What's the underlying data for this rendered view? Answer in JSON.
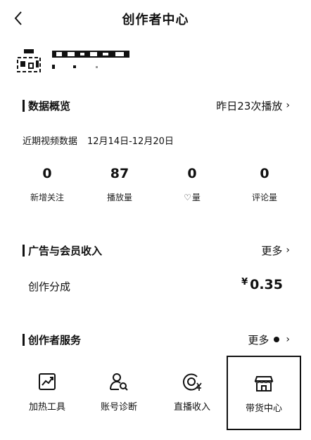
{
  "header": {
    "title": "创作者中心",
    "back_icon": "chevron-left-icon"
  },
  "overview": {
    "title": "数据概览",
    "yesterday": "昨日23次播放",
    "period_label": "近期视频数据",
    "period_range": "12月14日-12月20日",
    "stats": [
      {
        "value": "0",
        "label": "新增关注"
      },
      {
        "value": "87",
        "label": "播放量"
      },
      {
        "value": "0",
        "label": "赞量",
        "icon": "heart-icon",
        "label_text": "量"
      },
      {
        "value": "0",
        "label": "评论量"
      }
    ]
  },
  "income": {
    "title": "广告与会员收入",
    "more": "更多",
    "item_label": "创作分成",
    "currency": "¥",
    "amount": "0.35"
  },
  "services": {
    "title": "创作者服务",
    "more": "更多",
    "items": [
      {
        "label": "加热工具",
        "icon": "trend-chart-icon"
      },
      {
        "label": "账号诊断",
        "icon": "user-search-icon"
      },
      {
        "label": "直播收入",
        "icon": "live-income-icon"
      },
      {
        "label": "带货中心",
        "icon": "store-icon"
      }
    ]
  }
}
